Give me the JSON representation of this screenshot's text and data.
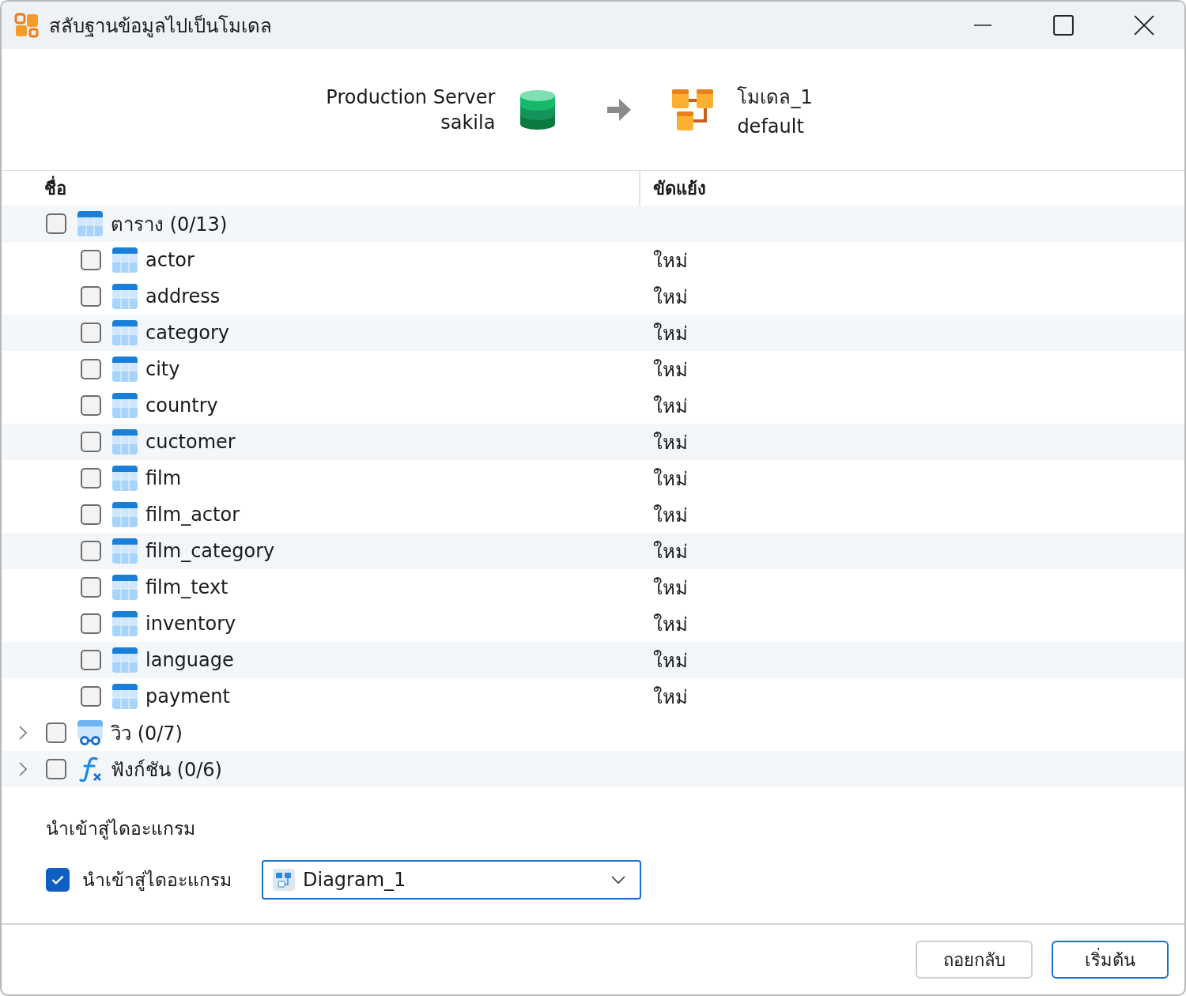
{
  "window": {
    "title": "สลับฐานข้อมูลไปเป็นโมเดล"
  },
  "source": {
    "server": "Production Server",
    "database": "sakila"
  },
  "target": {
    "model": "โมเดล_1",
    "schema": "default"
  },
  "table": {
    "columns": [
      "ชื่อ",
      "ขัดแย้ง"
    ],
    "groups": [
      {
        "kind": "table",
        "label": "ตาราง (0/13)",
        "expanded": true,
        "checked": false,
        "children": [
          {
            "name": "actor",
            "conflict": "ใหม่",
            "checked": false
          },
          {
            "name": "address",
            "conflict": "ใหม่",
            "checked": false
          },
          {
            "name": "category",
            "conflict": "ใหม่",
            "checked": false
          },
          {
            "name": "city",
            "conflict": "ใหม่",
            "checked": false
          },
          {
            "name": "country",
            "conflict": "ใหม่",
            "checked": false
          },
          {
            "name": "cuctomer",
            "conflict": "ใหม่",
            "checked": false
          },
          {
            "name": "film",
            "conflict": "ใหม่",
            "checked": false
          },
          {
            "name": "film_actor",
            "conflict": "ใหม่",
            "checked": false
          },
          {
            "name": "film_category",
            "conflict": "ใหม่",
            "checked": false
          },
          {
            "name": "film_text",
            "conflict": "ใหม่",
            "checked": false
          },
          {
            "name": "inventory",
            "conflict": "ใหม่",
            "checked": false
          },
          {
            "name": "language",
            "conflict": "ใหม่",
            "checked": false
          },
          {
            "name": "payment",
            "conflict": "ใหม่",
            "checked": false
          }
        ]
      },
      {
        "kind": "view",
        "label": "วิว (0/7)",
        "expanded": false,
        "checked": false
      },
      {
        "kind": "function",
        "label": "ฟังก์ชัน (0/6)",
        "expanded": false,
        "checked": false
      }
    ]
  },
  "import": {
    "heading": "นำเข้าสู่ไดอะแกรม",
    "label": "นำเข้าสู่ไดอะแกรม",
    "checked": true,
    "diagram": "Diagram_1"
  },
  "buttons": [
    "ถอยกลับ",
    "เริ่มต้น"
  ]
}
